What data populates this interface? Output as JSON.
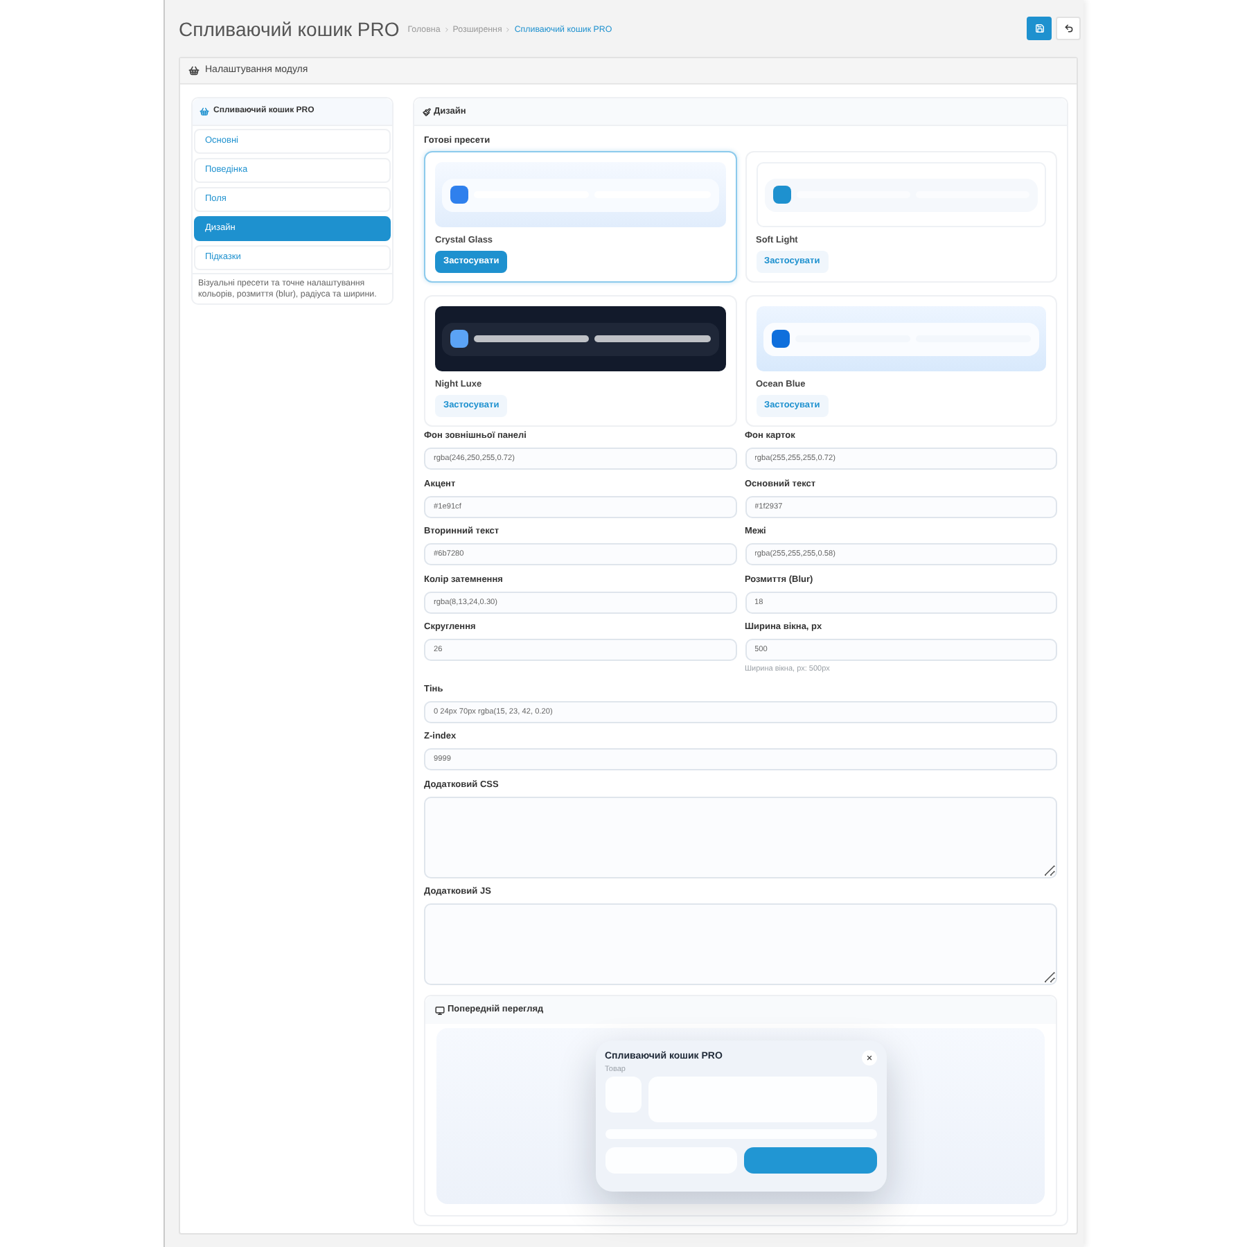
{
  "header": {
    "title": "Спливаючий кошик PRO",
    "breadcrumbs": [
      {
        "label": "Головна",
        "selected": false
      },
      {
        "label": "Розширення",
        "selected": false
      },
      {
        "label": "Спливаючий кошик PRO",
        "selected": true
      }
    ]
  },
  "panel": {
    "title": "Налаштування модуля"
  },
  "sidebar": {
    "title": "Спливаючий кошик PRO",
    "items": [
      {
        "label": "Основні",
        "selected": false
      },
      {
        "label": "Поведінка",
        "selected": false
      },
      {
        "label": "Поля",
        "selected": false
      },
      {
        "label": "Дизайн",
        "selected": true
      },
      {
        "label": "Підказки",
        "selected": false
      }
    ],
    "description": "Візуальні пресети та точне налаштування кольорів, розмиття (blur), радіуса та ширини."
  },
  "design": {
    "title": "Дизайн",
    "presets_label": "Готові пресети",
    "presets": [
      {
        "name": "Crystal Glass",
        "kind": "crystal",
        "selected": true,
        "button": "Застосувати"
      },
      {
        "name": "Soft Light",
        "kind": "soft",
        "selected": false,
        "button": "Застосувати"
      },
      {
        "name": "Night Luxe",
        "kind": "night",
        "selected": false,
        "button": "Застосувати"
      },
      {
        "name": "Ocean Blue",
        "kind": "ocean",
        "selected": false,
        "button": "Застосувати"
      }
    ],
    "field_rows": [
      [
        {
          "kind": "input",
          "label": "Фон зовнішньої панелі",
          "value": "rgba(246,250,255,0.72)"
        },
        {
          "kind": "input",
          "label": "Фон карток",
          "value": "rgba(255,255,255,0.72)"
        }
      ],
      [
        {
          "kind": "input",
          "label": "Акцент",
          "value": "#1e91cf"
        },
        {
          "kind": "input",
          "label": "Основний текст",
          "value": "#1f2937"
        }
      ],
      [
        {
          "kind": "input",
          "label": "Вторинний текст",
          "value": "#6b7280"
        },
        {
          "kind": "input",
          "label": "Межі",
          "value": "rgba(255,255,255,0.58)"
        }
      ],
      [
        {
          "kind": "input",
          "label": "Колір затемнення",
          "value": "rgba(8,13,24,0.30)"
        },
        {
          "kind": "input",
          "label": "Розмиття (Blur)",
          "value": "18"
        }
      ],
      [
        {
          "kind": "input",
          "label": "Скруглення",
          "value": "26"
        },
        {
          "kind": "input",
          "label": "Ширина вікна, px",
          "value": "500",
          "hint": "Ширина вікна, px: 500px"
        }
      ],
      [
        {
          "kind": "input",
          "label": "Тінь",
          "value": "0 24px 70px rgba(15, 23, 42, 0.20)"
        }
      ],
      [
        {
          "kind": "input",
          "label": "Z-index",
          "value": "9999"
        }
      ],
      [
        {
          "kind": "textarea",
          "label": "Додатковий CSS"
        }
      ],
      [
        {
          "kind": "textarea",
          "label": "Додатковий JS"
        }
      ]
    ]
  },
  "preview": {
    "title": "Попередній перегляд",
    "popup": {
      "title": "Спливаючий кошик PRO",
      "subtitle": "Товар"
    }
  }
}
